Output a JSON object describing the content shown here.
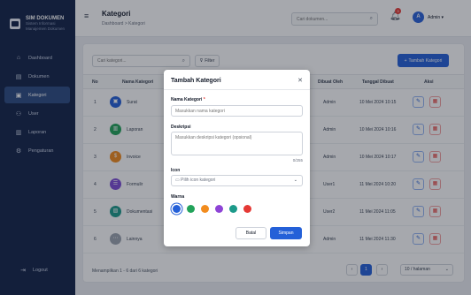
{
  "sidebar": {
    "brand_title": "SIM DOKUMEN",
    "brand_subtitle_1": "Sistem Informasi",
    "brand_subtitle_2": "Manajemen Dokumen",
    "items": [
      {
        "label": "Dashboard",
        "icon": "home-icon"
      },
      {
        "label": "Dokumen",
        "icon": "document-icon"
      },
      {
        "label": "Kategori",
        "icon": "folder-icon"
      },
      {
        "label": "User",
        "icon": "user-icon"
      },
      {
        "label": "Laporan",
        "icon": "report-icon"
      },
      {
        "label": "Pengaturan",
        "icon": "gear-icon"
      }
    ],
    "active_item": "Kategori",
    "logout_label": "Logout"
  },
  "topbar": {
    "title": "Kategori",
    "breadcrumb": "Dashboard > Kategori",
    "search_placeholder": "Cari dokumen...",
    "notification_count": "3",
    "avatar_initial": "A",
    "user_name": "Admin ▾"
  },
  "toolbar": {
    "search_placeholder": "Cari kategori...",
    "filter_label": "Filter",
    "add_label": "Tambah Kategori"
  },
  "table": {
    "columns": [
      "No",
      "Nama Kategori",
      "Dibuat Oleh",
      "Tanggal Dibuat",
      "Aksi"
    ],
    "rows": [
      {
        "no": "1",
        "name": "Surat",
        "by": "Admin",
        "date": "10 Mei 2024 10:15",
        "color": "#2460d8",
        "icon": "folder-icon"
      },
      {
        "no": "2",
        "name": "Laporan",
        "by": "Admin",
        "date": "10 Mei 2024 10:16",
        "color": "#22a35a",
        "icon": "report-icon"
      },
      {
        "no": "3",
        "name": "Invoice",
        "by": "Admin",
        "date": "10 Mei 2024 10:17",
        "color": "#f28c1e",
        "icon": "invoice-icon"
      },
      {
        "no": "4",
        "name": "Formulir",
        "by": "User1",
        "date": "11 Mei 2024 10:20",
        "color": "#7c4dd6",
        "icon": "form-icon"
      },
      {
        "no": "5",
        "name": "Dokumentasi",
        "by": "User2",
        "date": "11 Mei 2024 11:05",
        "color": "#1c9a8a",
        "icon": "image-icon"
      },
      {
        "no": "6",
        "name": "Lainnya",
        "by": "Admin",
        "date": "11 Mei 2024 11:30",
        "color": "#9ca3af",
        "icon": "dots-icon"
      }
    ]
  },
  "pagination": {
    "summary": "Menampilkan 1 - 6 dari 6 kategori",
    "prev": "‹",
    "current": "1",
    "next": "›",
    "per_page": "10 / halaman"
  },
  "modal": {
    "title": "Tambah Kategori",
    "name_label": "Nama Kategori",
    "name_placeholder": "Masukkan nama kategori",
    "desc_label": "Deskripsi",
    "desc_placeholder": "Masukkan deskripsi kategori (opsional)",
    "char_count": "0/255",
    "icon_label": "Icon",
    "icon_placeholder": "Pilih icon kategori",
    "color_label": "Warna",
    "colors": [
      "#2460d8",
      "#22a35a",
      "#f28c1e",
      "#8e44d6",
      "#1c9a8a",
      "#e53935"
    ],
    "selected_color": "#2460d8",
    "cancel_label": "Batal",
    "save_label": "Simpan"
  }
}
